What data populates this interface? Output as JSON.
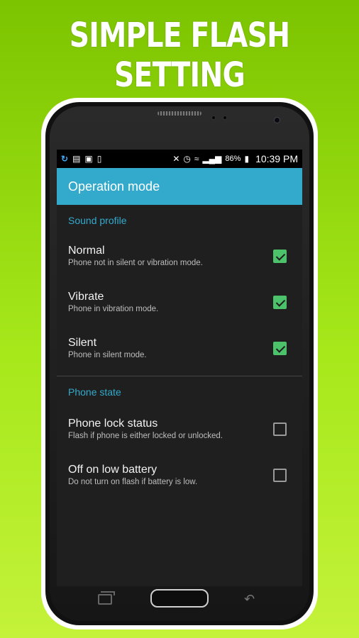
{
  "promo": {
    "headline": "SIMPLE FLASH SETTING"
  },
  "statusbar": {
    "battery": "86%",
    "time": "10:39 PM"
  },
  "appbar": {
    "title": "Operation mode"
  },
  "sections": [
    {
      "title": "Sound profile",
      "items": [
        {
          "title": "Normal",
          "subtitle": "Phone not in silent or vibration mode.",
          "checked": true
        },
        {
          "title": "Vibrate",
          "subtitle": "Phone in vibration mode.",
          "checked": true
        },
        {
          "title": "Silent",
          "subtitle": "Phone in silent mode.",
          "checked": true
        }
      ]
    },
    {
      "title": "Phone state",
      "items": [
        {
          "title": "Phone lock status",
          "subtitle": "Flash if phone is either locked or unlocked.",
          "checked": false
        },
        {
          "title": "Off on low battery",
          "subtitle": "Do not turn on flash if battery is low.",
          "checked": false
        }
      ]
    }
  ],
  "colors": {
    "accent": "#33aacc",
    "check": "#4cc26a",
    "background": "#1f1f1f"
  }
}
